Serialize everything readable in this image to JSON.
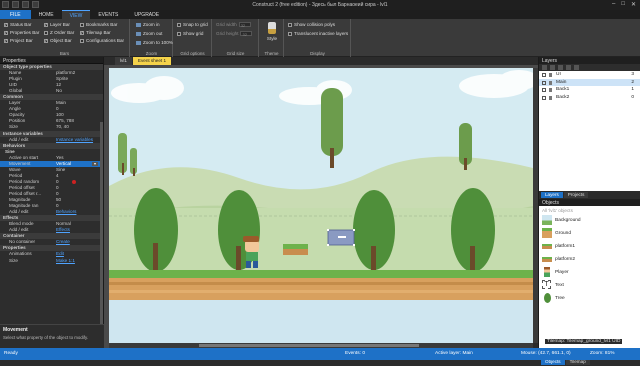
{
  "window": {
    "title": "Construct 2  (free edition) - Здесь был Барнаоеий сира - lvl1"
  },
  "menu_tabs": [
    "FILE",
    "HOME",
    "VIEW",
    "EVENTS",
    "UPGRADE"
  ],
  "ribbon": {
    "bars": {
      "col1": [
        "Status Bar",
        "Properties Bar",
        "Project Bar"
      ],
      "col2": [
        "Layer Bar",
        "Z Order Bar",
        "Object Bar"
      ],
      "col3": [
        "Bookmarks Bar",
        "Tilemap Bar",
        "Configurations Bar"
      ],
      "title": "Bars"
    },
    "zoom": {
      "items": [
        "Zoom in",
        "Zoom out",
        "Zoom to 100%"
      ],
      "title": "Zoom"
    },
    "grid_options": {
      "items": [
        "Snap to grid",
        "Show grid"
      ],
      "title": "Grid options"
    },
    "grid_size": {
      "labels": [
        "Grid width",
        "Grid height"
      ],
      "values": [
        "32",
        "32"
      ],
      "title": "Grid size"
    },
    "theme": {
      "label": "Style",
      "title": "Theme"
    },
    "display": {
      "items": [
        "Show collision polys",
        "Translucent inactive layers"
      ],
      "title": "Display"
    }
  },
  "properties": {
    "header": "Properties",
    "rows": [
      {
        "t": "sect",
        "k": "Object type properties"
      },
      {
        "t": "kv",
        "k": "Name",
        "v": "platform2"
      },
      {
        "t": "kv",
        "k": "Plugin",
        "v": "Sprite"
      },
      {
        "t": "kv",
        "k": "UID",
        "v": "12"
      },
      {
        "t": "kv",
        "k": "Global",
        "v": "No"
      },
      {
        "t": "sect",
        "k": "Common"
      },
      {
        "t": "kv",
        "k": "Layer",
        "v": "Main"
      },
      {
        "t": "kv",
        "k": "Angle",
        "v": "0"
      },
      {
        "t": "kv",
        "k": "Opacity",
        "v": "100"
      },
      {
        "t": "kv",
        "k": "Position",
        "v": "675, 788"
      },
      {
        "t": "kv",
        "k": "Size",
        "v": "70, 40"
      },
      {
        "t": "sect",
        "k": "Instance variables"
      },
      {
        "t": "link",
        "k": "Add / edit",
        "v": "Instance variables"
      },
      {
        "t": "sect",
        "k": "Behaviors"
      },
      {
        "t": "sub",
        "k": "Sine"
      },
      {
        "t": "kv",
        "k": "Active on start",
        "v": "Yes"
      },
      {
        "t": "sel",
        "k": "Movement",
        "v": "Vertical"
      },
      {
        "t": "kv",
        "k": "Wave",
        "v": "Sine"
      },
      {
        "t": "kv",
        "k": "Period",
        "v": "4"
      },
      {
        "t": "kv",
        "k": "Period random",
        "v": "0"
      },
      {
        "t": "kv",
        "k": "Period offset",
        "v": "0"
      },
      {
        "t": "kv",
        "k": "Period offset r...",
        "v": "0"
      },
      {
        "t": "kv",
        "k": "Magnitude",
        "v": "50"
      },
      {
        "t": "kv",
        "k": "Magnitude ran",
        "v": "0"
      },
      {
        "t": "link",
        "k": "Add / edit",
        "v": "Behaviors"
      },
      {
        "t": "sect",
        "k": "Effects"
      },
      {
        "t": "kv",
        "k": "Blend mode",
        "v": "Normal"
      },
      {
        "t": "link",
        "k": "Add / edit",
        "v": "Effects"
      },
      {
        "t": "sect",
        "k": "Container"
      },
      {
        "t": "link",
        "k": "No container",
        "v": "Create"
      },
      {
        "t": "sect",
        "k": "Properties"
      },
      {
        "t": "link",
        "k": "Animations",
        "v": "Edit"
      },
      {
        "t": "link",
        "k": "Size",
        "v": "Make 1:1"
      }
    ],
    "footer_title": "Movement",
    "footer_desc": "Select what property of the object to modify."
  },
  "doc_tabs": [
    "lvl1",
    "Event sheet 1"
  ],
  "layers": {
    "header": "Layers",
    "items": [
      {
        "name": "UI",
        "index": "3"
      },
      {
        "name": "Main",
        "index": "2",
        "selected": true
      },
      {
        "name": "Back1",
        "index": "1"
      },
      {
        "name": "Back2",
        "index": "0"
      }
    ]
  },
  "right_tabs": [
    "Layers",
    "Projects"
  ],
  "objects": {
    "header": "Objects",
    "filter": "All 'lvl1' objects",
    "items": [
      {
        "name": "Background",
        "icon": "background-icon"
      },
      {
        "name": "Ground",
        "icon": "ground-icon"
      },
      {
        "name": "platform1",
        "icon": "platform-icon"
      },
      {
        "name": "platform2",
        "icon": "platform-icon"
      },
      {
        "name": "Player",
        "icon": "player-icon"
      },
      {
        "name": "Text",
        "icon": "text-icon"
      },
      {
        "name": "Tree",
        "icon": "tree-icon"
      }
    ]
  },
  "bottom_tabs": [
    "Objects",
    "Tilemap"
  ],
  "status": {
    "ready": "Ready",
    "events": "Events: 0",
    "active_layer": "Active layer: Main",
    "mouse": "Mouse: (42.7, 661.1, 0)",
    "zoom": "Zoom: 81%",
    "tilemap": "Tilemap: Tilemap_ground_lvl1 UID"
  },
  "colors": {
    "accent": "#1e71c7",
    "event_sheet_tab": "#f5d34a",
    "grass": "#6db24b",
    "dirt": "#d49b5a"
  }
}
